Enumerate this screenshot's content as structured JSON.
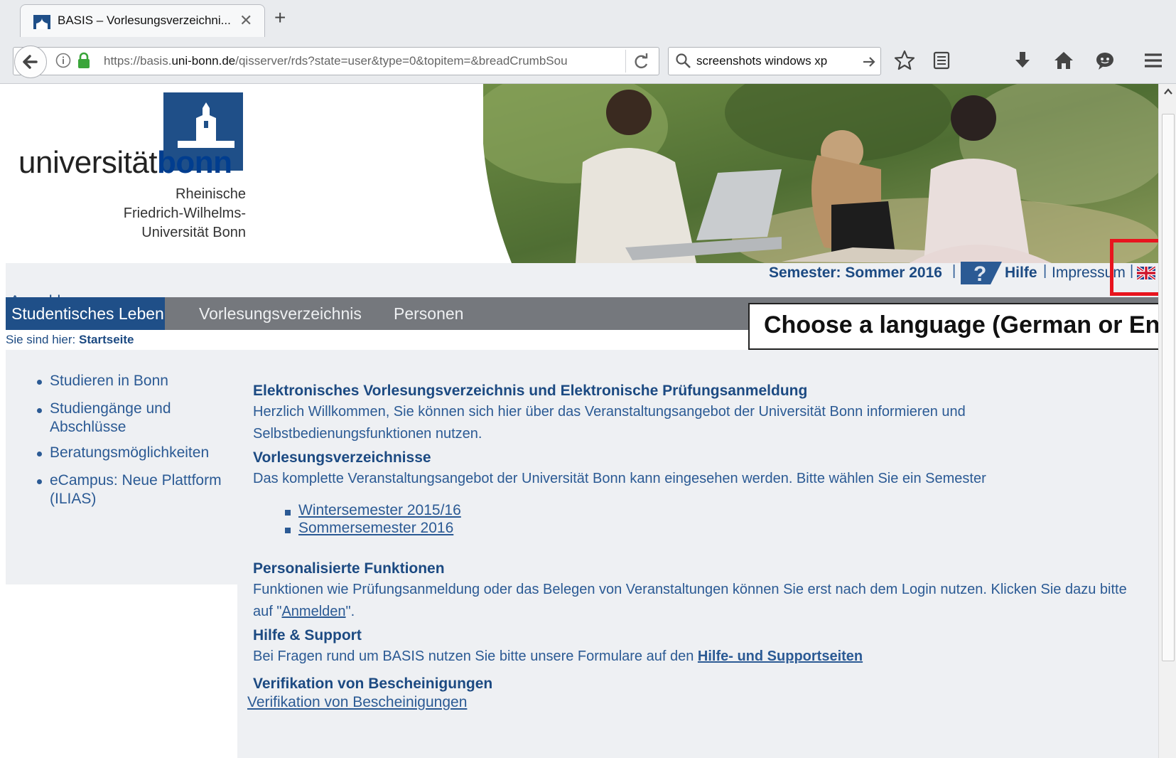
{
  "browser": {
    "tab_title": "BASIS – Vorlesungsverzeichni...",
    "tab_close": "✕",
    "new_tab": "+",
    "url_prefix": "https://basis.",
    "url_domain": "uni-bonn.de",
    "url_rest": "/qisserver/rds?state=user&type=0&topitem=&breadCrumbSou",
    "search_query": "screenshots windows xp"
  },
  "logo": {
    "word_light": "universität",
    "word_bold": "bonn",
    "subtitle_line1": "Rheinische",
    "subtitle_line2": "Friedrich-Wilhelms-",
    "subtitle_line3": "Universität Bonn"
  },
  "meta": {
    "semester": "Semester: Sommer 2016",
    "separator": "|",
    "help": "Hilfe",
    "impressum": "Impressum"
  },
  "login_link": "Anmelden",
  "nav": {
    "items": [
      "Studentisches Leben",
      "Vorlesungsverzeichnis",
      "Personen"
    ]
  },
  "callout": "Choose a language (German or English)",
  "breadcrumb": {
    "prefix": "Sie sind hier:",
    "current": "Startseite"
  },
  "sidebar": {
    "items": [
      "Studieren in Bonn",
      "Studiengänge und Abschlüsse",
      "Beratungsmöglichkeiten",
      "eCampus: Neue Plattform (ILIAS)"
    ]
  },
  "content": {
    "s1_title": "Elektronisches Vorlesungsverzeichnis und Elektronische Prüfungsanmeldung",
    "s1_text": "Herzlich Willkommen, Sie können sich hier über das Veranstaltungsangebot der Universität Bonn informieren und Selbstbedienungsfunktionen nutzen.",
    "s2_title": "Vorlesungsverzeichnisse",
    "s2_text": "Das komplette Veranstaltungsangebot der Universität Bonn kann eingesehen werden. Bitte wählen Sie ein Semester",
    "s2_links": [
      "Wintersemester 2015/16",
      "Sommersemester 2016"
    ],
    "s3_title": "Personalisierte Funktionen",
    "s3_text_before": "Funktionen wie Prüfungsanmeldung oder das Belegen von Veranstaltungen können Sie erst nach dem Login nutzen. Klicken Sie dazu bitte auf \"",
    "s3_link": "Anmelden",
    "s3_text_after": "\".",
    "s4_title": "Hilfe & Support",
    "s4_text": "Bei Fragen rund um BASIS nutzen Sie bitte unsere Formulare auf den ",
    "s4_link": "Hilfe- und Supportseiten",
    "s5_title": "Verifikation von Bescheinigungen",
    "s5_link": "Verifikation von Bescheinigungen"
  },
  "colors": {
    "brand_blue": "#1c4a82",
    "link_blue": "#2b5a94",
    "nav_gray": "#75787d",
    "nav_active": "#1f4f88",
    "highlight_red": "#e8141e"
  }
}
